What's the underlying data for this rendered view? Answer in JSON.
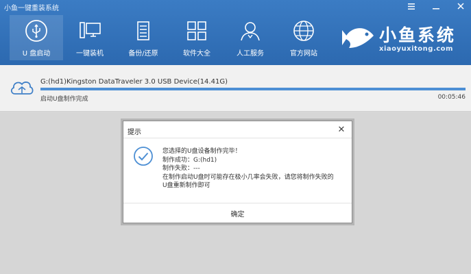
{
  "window": {
    "title": "小鱼一键重装系统"
  },
  "nav": {
    "items": [
      {
        "label": "U 盘启动",
        "icon": "usb-icon"
      },
      {
        "label": "一键装机",
        "icon": "computer-icon"
      },
      {
        "label": "备份/还原",
        "icon": "backup-icon"
      },
      {
        "label": "软件大全",
        "icon": "apps-grid-icon"
      },
      {
        "label": "人工服务",
        "icon": "user-service-icon"
      },
      {
        "label": "官方网站",
        "icon": "globe-icon"
      }
    ]
  },
  "logo": {
    "text": "小鱼系统",
    "sub": "xiaoyuxitong.com"
  },
  "progress": {
    "device": "G:(hd1)Kingston DataTraveler 3.0 USB Device(14.41G)",
    "status": "启动U盘制作完成",
    "time": "00:05:46",
    "percent": 100
  },
  "dialog": {
    "title": "提示",
    "lines": [
      "您选择的U盘设备制作完毕！",
      "制作成功：G:(hd1)",
      "制作失败：---",
      "在制作启动U盘时可能存在极小几率会失败，请您将制作失败的",
      "U盘重新制作即可"
    ],
    "ok_label": "确定"
  },
  "colors": {
    "header": "#2f6fb6",
    "accent": "#4d8fd4"
  }
}
